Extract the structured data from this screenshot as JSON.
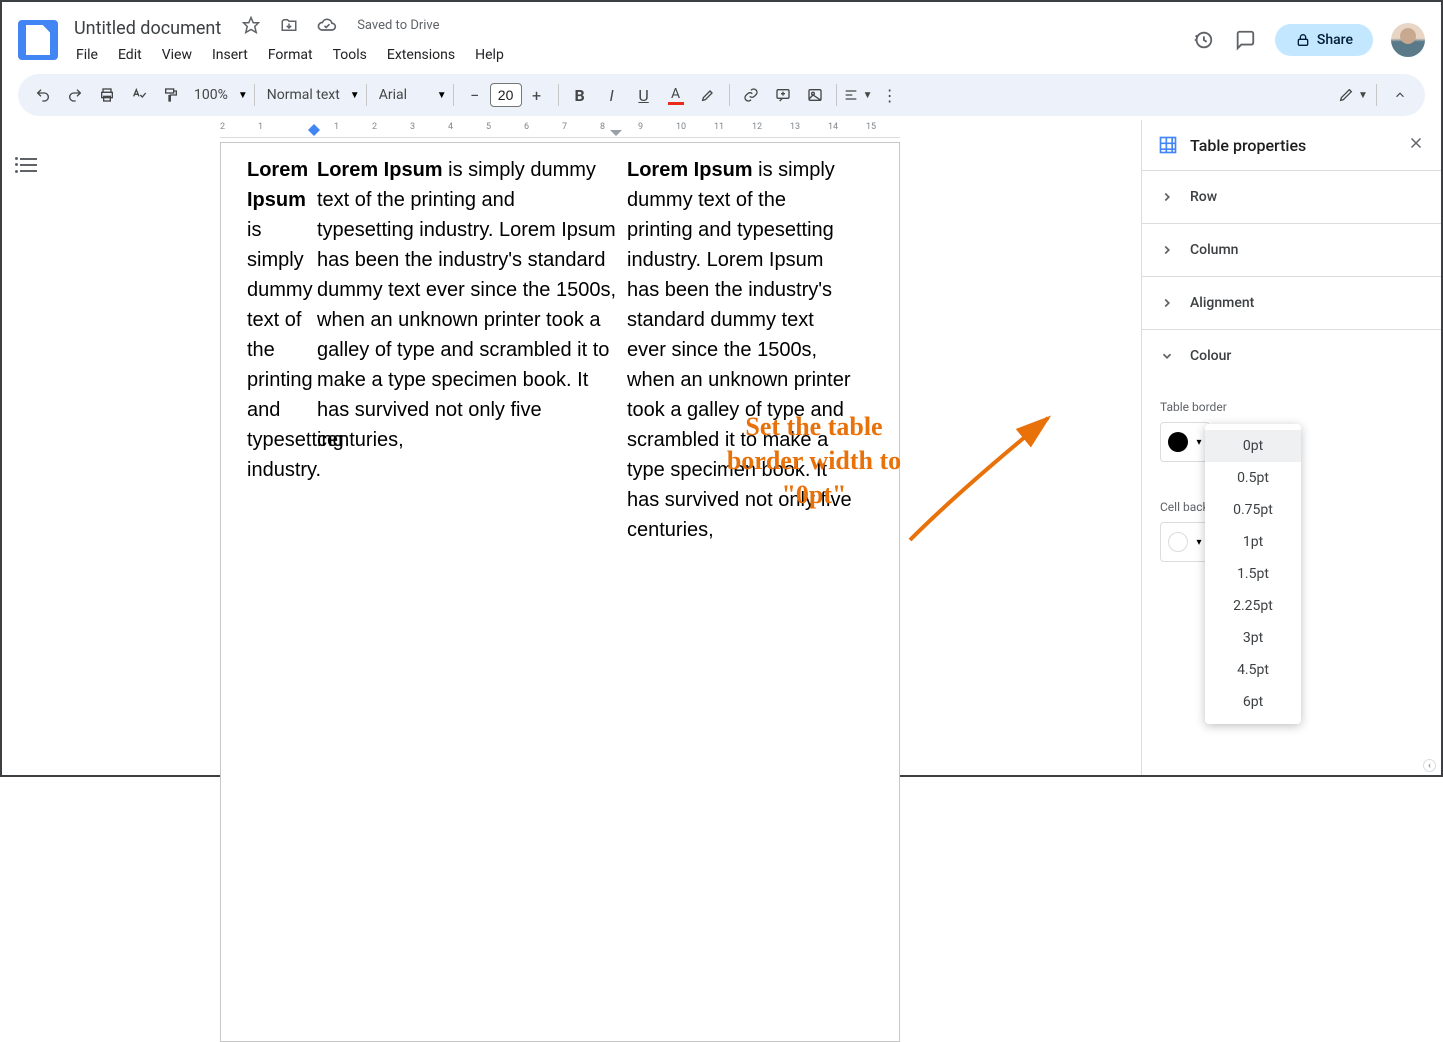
{
  "header": {
    "title": "Untitled document",
    "save_status": "Saved to Drive",
    "menu": [
      "File",
      "Edit",
      "View",
      "Insert",
      "Format",
      "Tools",
      "Extensions",
      "Help"
    ],
    "share": "Share"
  },
  "toolbar": {
    "zoom": "100%",
    "style": "Normal text",
    "font": "Arial",
    "size": "20"
  },
  "ruler": {
    "h": [
      "2",
      "1",
      "",
      "1",
      "2",
      "3",
      "4",
      "5",
      "6",
      "7",
      "8",
      "9",
      "10",
      "11",
      "12",
      "13",
      "14",
      "15"
    ]
  },
  "document": {
    "bold": "Lorem Ipsum",
    "col1": " is simply dummy text of the printing and typesetting industry.",
    "col2": " is simply dummy text of the printing and typesetting industry. Lorem Ipsum has been the industry's standard dummy text ever since the 1500s, when an unknown printer took a galley of type and scrambled it to make a type specimen book. It has survived not only five centuries,",
    "col3": " is simply dummy text of the printing and typesetting industry. Lorem Ipsum has been the industry's standard dummy text ever since the 1500s, when an unknown printer took a galley of type and scrambled it to make a type specimen book. It has survived not only five centuries,"
  },
  "sidepanel": {
    "title": "Table properties",
    "sections": {
      "row": "Row",
      "column": "Column",
      "alignment": "Alignment",
      "colour": "Colour"
    },
    "table_border_label": "Table border",
    "cell_bg_label": "Cell background",
    "border_width_options": [
      "0pt",
      "0.5pt",
      "0.75pt",
      "1pt",
      "1.5pt",
      "2.25pt",
      "3pt",
      "4.5pt",
      "6pt"
    ]
  },
  "annotation": {
    "text": "Set the table border width to \"0pt\""
  }
}
